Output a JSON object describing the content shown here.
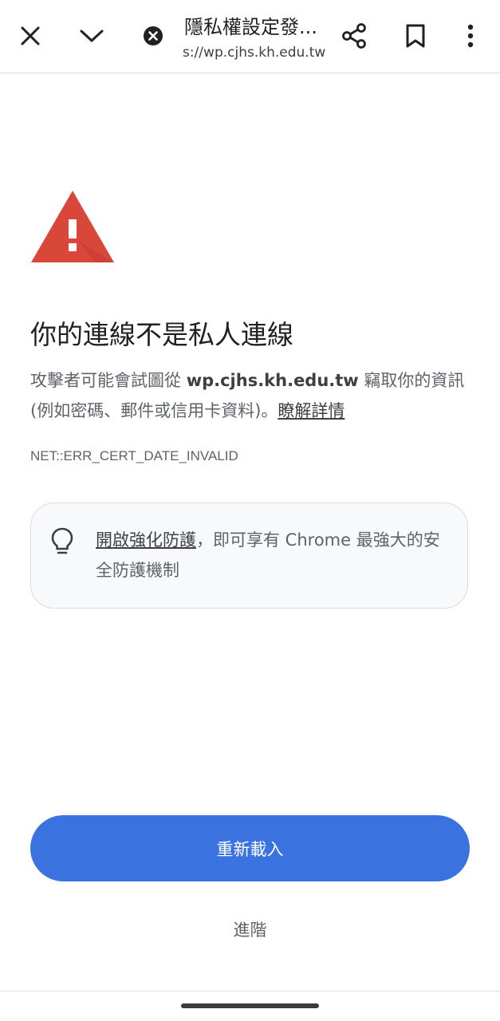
{
  "toolbar": {
    "title": "隱私權設定發...",
    "url": "s://wp.cjhs.kh.edu.tw",
    "icons": [
      "close-icon",
      "chevron-down-icon",
      "site-error-icon",
      "share-icon",
      "bookmark-icon",
      "more-vert-icon"
    ]
  },
  "interstitial": {
    "heading": "你的連線不是私人連線",
    "desc_prefix": "攻擊者可能會試圖從 ",
    "desc_domain": "wp.cjhs.kh.edu.tw",
    "desc_suffix": " 竊取你的資訊 (例如密碼、郵件或信用卡資料)。",
    "learn_more": "瞭解詳情",
    "error_code": "NET::ERR_CERT_DATE_INVALID",
    "tip_link": "開啟強化防護",
    "tip_text": "，即可享有 Chrome 最強大的安全防護機制",
    "reload_label": "重新載入",
    "advanced_label": "進階"
  },
  "colors": {
    "accent": "#3a73e0",
    "warning_red": "#d9473b",
    "text_primary": "#202124",
    "text_secondary": "#5f6368"
  }
}
